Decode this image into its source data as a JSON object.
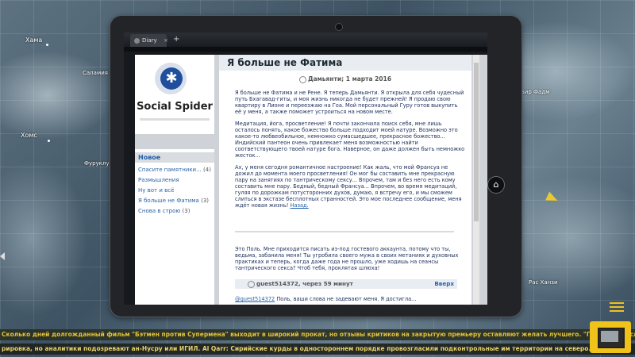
{
  "map": {
    "labels": [
      "Хама",
      "Саламия",
      "Хомс",
      "Фуруклус",
      "Бир Фадм",
      "Рас Ханзи"
    ]
  },
  "browser": {
    "tab_label": "Diary",
    "tab_close": "×",
    "tab_add": "+"
  },
  "site": {
    "name": "Social Spider"
  },
  "sidebar": {
    "heading": "Новое",
    "items": [
      {
        "label": "Спасите памятники...",
        "count": "(4)"
      },
      {
        "label": "Размышления",
        "count": ""
      },
      {
        "label": "Ну вот и всё",
        "count": ""
      },
      {
        "label": "Я больше не Фатима",
        "count": "(3)"
      },
      {
        "label": "Снова в строю",
        "count": "(3)"
      }
    ]
  },
  "post": {
    "title": "Я больше не Фатима",
    "meta": "Дамьянти; 1 марта 2016",
    "paragraphs": [
      "Я больше не Фатима и не Рене. Я теперь Дамьянти. Я открыла для себя чудесный путь Бхагавад-гиты, и моя жизнь никогда не будет прежней! Я продаю свою квартиру в Лионе и переезжаю на Гоа. Мой персональный Гуру готов выкупить её у меня, а также поможет устроиться на новом месте.",
      "Медитация, йога, просветление! Я почти закончила поиск себя, мне лишь осталось понять, какое божество больше подходит моей натуре. Возможно это какое-то любвеобильное, немножко сумасшедшее, прекрасное божество... Индийский пантеон очень привлекает меня возможностью найти соответствующего твоей натуре бога. Наверное, он даже должен быть немножко жесток...",
      "Ах, у меня сегодня романтичное настроение! Как жаль, что мой Франсуа не дожил до момента моего просветления! Он мог бы составить мне прекрасную пару на занятиях по тантрическому сексу... Впрочем, там и без него есть кому составить мне пару. Бедный, бедный Франсуа... Впрочем, во время медитаций, гуляя по дорожкам потусторонних духов, думаю, я встречу его, и мы сможем слиться в экстазе бесплотных странностей. Это мое последнее сообщение, меня ждёт новая жизнь!"
    ],
    "back_link": "Назад."
  },
  "comments": [
    {
      "text": "Это Поль. Мне приходится писать из-под гостевого аккаунта, потому что ты, ведьма, забанила меня! Ты угробила своего мужа в своих метаниях и духовных практиках и теперь, когда даже года не прошло, уже ходишь на сеансы тантрического секса? Чтоб тебя, проклятая шлюха!",
      "author": "guest514372, через 59 минут",
      "up": "Вверх"
    },
    {
      "author": "@guest514372",
      "text": "Поль, ваши слова не задевают меня. Я достигла..."
    }
  ],
  "ticker": {
    "line1": "Сколько дней долгожданный фильм \"Бэтмен против Супермена\" выходит в широкий прокат, но отзывы критиков на закрытую премьеру оставляют желать лучшего. \"Происходит слишком много всего...",
    "line2": "рировка, но аналитики подозревают ан-Нусру или ИГИЛ.          Al Qarr: Сирийские курды в одностороннем порядке провозгласили подконтрольные им территории на северо..."
  },
  "colors": {
    "accent": "#f2c11a",
    "link": "#2a63a8",
    "ticker_text": "#e2c23a"
  }
}
